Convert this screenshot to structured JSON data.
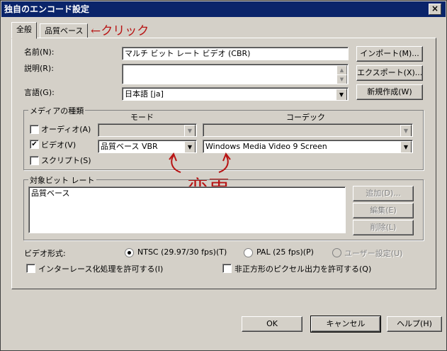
{
  "window": {
    "title": "独自のエンコード設定",
    "close": "×"
  },
  "tabs": [
    {
      "label": "全般"
    },
    {
      "label": "品質ベース"
    }
  ],
  "annotations": {
    "click": "←クリック",
    "change": "変更"
  },
  "general": {
    "name_label": "名前(N):",
    "name_value": "マルチ ビット レート ビデオ (CBR)",
    "description_label": "説明(R):",
    "description_value": "",
    "language_label": "言語(G):",
    "language_value": "日本語 [ja]",
    "import_button": "インポート(M)...",
    "export_button": "エクスポート(X)...",
    "new_button": "新規作成(W)"
  },
  "media": {
    "group_label": "メディアの種類",
    "mode_header": "モード",
    "codec_header": "コーデック",
    "audio_label": "オーディオ(A)",
    "audio_checked": false,
    "video_label": "ビデオ(V)",
    "video_checked": true,
    "video_mode": "品質ベース VBR",
    "video_codec": "Windows Media Video 9 Screen",
    "script_label": "スクリプト(S)",
    "script_checked": false
  },
  "bitrate": {
    "group_label": "対象ビット レート",
    "items": [
      "品質ベース"
    ],
    "add_button": "追加(D)...",
    "edit_button": "編集(E)",
    "delete_button": "削除(L)"
  },
  "video_format": {
    "label": "ビデオ形式:",
    "ntsc": "NTSC (29.97/30 fps)(T)",
    "pal": "PAL (25 fps)(P)",
    "user": "ユーザー設定(U)",
    "selected": "ntsc"
  },
  "options": {
    "interlace": "インターレース化処理を許可する(I)",
    "nonsquare": "非正方形のピクセル出力を許可する(Q)"
  },
  "footer": {
    "ok": "OK",
    "cancel": "キャンセル",
    "help": "ヘルプ(H)"
  }
}
